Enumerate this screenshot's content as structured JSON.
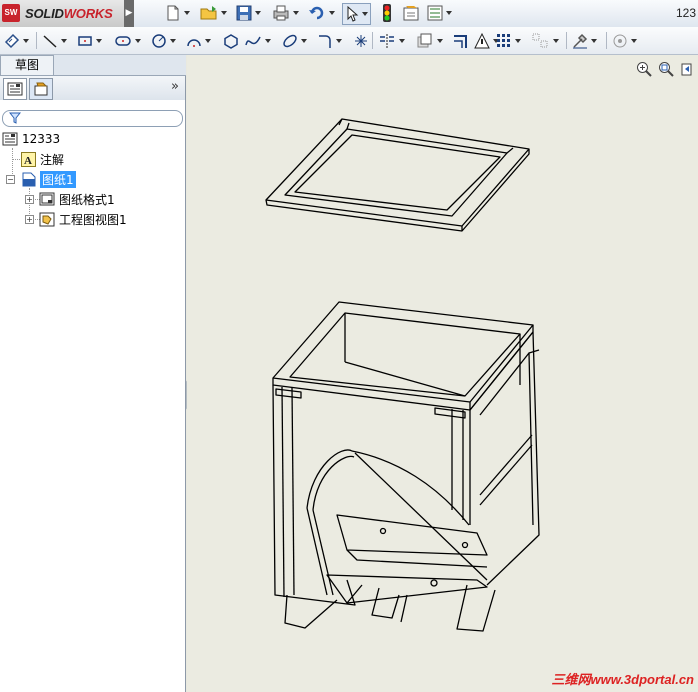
{
  "app": {
    "brand_prefix": "SOLID",
    "brand_suffix": "WORKS",
    "badge": "SW",
    "window_title": "123"
  },
  "toolbar": {
    "items": [
      "new-document-icon",
      "open-folder-icon",
      "save-icon",
      "print-icon",
      "undo-icon",
      "select-arrow-icon",
      "rebuild-traffic-light-icon",
      "file-properties-icon",
      "options-icon"
    ]
  },
  "sketch_toolbar": {
    "items": [
      "smart-dimension-icon",
      "line-icon",
      "rectangle-icon",
      "slot-icon",
      "circle-icon",
      "arc-icon",
      "polygon-icon",
      "spline-icon",
      "ellipse-icon",
      "fillet-icon",
      "point-icon",
      "mirror-icon",
      "offset-entities-icon",
      "trim-icon",
      "display-delete-relations-icon",
      "linear-pattern-icon",
      "move-entities-icon",
      "repair-sketch-icon",
      "quick-snaps-icon"
    ]
  },
  "tabs": {
    "sketch": "草图"
  },
  "feature_tree": {
    "root": "12333",
    "items": [
      {
        "label": "注解",
        "icon": "annotations-icon"
      },
      {
        "label": "图纸1",
        "icon": "sheet-icon",
        "selected": true
      },
      {
        "label": "图纸格式1",
        "icon": "sheet-format-icon"
      },
      {
        "label": "工程图视图1",
        "icon": "drawing-view-icon"
      }
    ]
  },
  "watermark": {
    "cn": "三维网",
    "url": "www.3dportal.cn"
  },
  "colors": {
    "canvas": "#ebebe1",
    "selection": "#3399ff",
    "brand_red": "#c8232c"
  }
}
